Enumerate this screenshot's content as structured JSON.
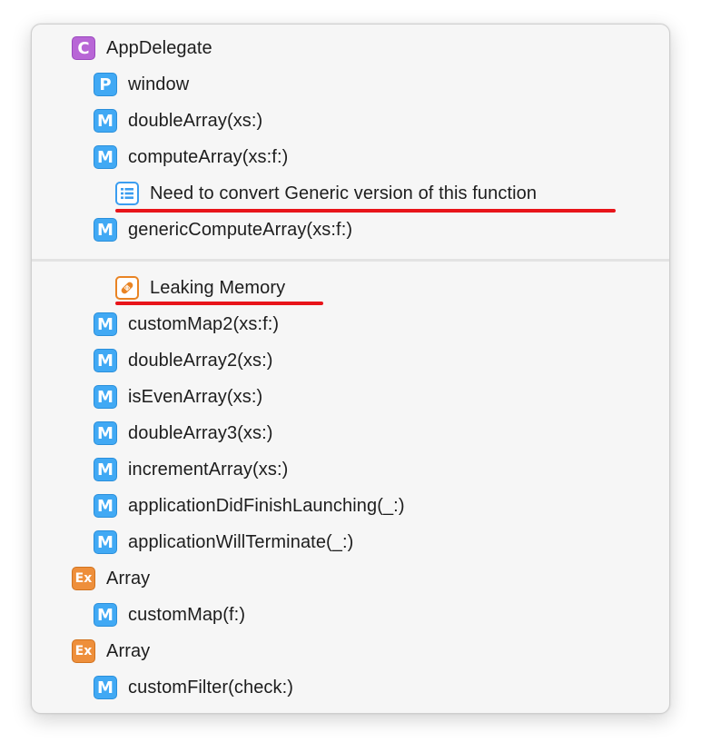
{
  "colors": {
    "class_badge": "#b866d6",
    "method_badge": "#41a9f4",
    "extension_badge": "#ee8f3b",
    "mark_badge_border": "#3b9df0",
    "fixme_badge_border": "#e98424",
    "annotation_underline": "#e8141a"
  },
  "symbols": [
    {
      "kind": "class",
      "badge": "C",
      "icon": "class-icon",
      "label": "AppDelegate"
    },
    {
      "kind": "property",
      "badge": "P",
      "icon": "property-icon",
      "label": "window"
    },
    {
      "kind": "method",
      "badge": "M",
      "icon": "method-icon",
      "label": "doubleArray(xs:)"
    },
    {
      "kind": "method",
      "badge": "M",
      "icon": "method-icon",
      "label": "computeArray(xs:f:)"
    },
    {
      "kind": "mark",
      "icon": "list-mark-icon",
      "label": "Need to convert Generic version of this function"
    },
    {
      "kind": "method",
      "badge": "M",
      "icon": "method-icon",
      "label": "genericComputeArray(xs:f:)"
    },
    {
      "kind": "fixme",
      "icon": "bandage-fixme-icon",
      "label": "Leaking Memory"
    },
    {
      "kind": "method",
      "badge": "M",
      "icon": "method-icon",
      "label": "customMap2(xs:f:)"
    },
    {
      "kind": "method",
      "badge": "M",
      "icon": "method-icon",
      "label": "doubleArray2(xs:)"
    },
    {
      "kind": "method",
      "badge": "M",
      "icon": "method-icon",
      "label": "isEvenArray(xs:)"
    },
    {
      "kind": "method",
      "badge": "M",
      "icon": "method-icon",
      "label": "doubleArray3(xs:)"
    },
    {
      "kind": "method",
      "badge": "M",
      "icon": "method-icon",
      "label": "incrementArray(xs:)"
    },
    {
      "kind": "method",
      "badge": "M",
      "icon": "method-icon",
      "label": "applicationDidFinishLaunching(_:)"
    },
    {
      "kind": "method",
      "badge": "M",
      "icon": "method-icon",
      "label": "applicationWillTerminate(_:)"
    },
    {
      "kind": "extension",
      "badge": "Ex",
      "icon": "extension-icon",
      "label": "Array"
    },
    {
      "kind": "method",
      "badge": "M",
      "icon": "method-icon",
      "label": "customMap(f:)"
    },
    {
      "kind": "extension",
      "badge": "Ex",
      "icon": "extension-icon",
      "label": "Array"
    },
    {
      "kind": "method",
      "badge": "M",
      "icon": "method-icon",
      "label": "customFilter(check:)"
    }
  ]
}
